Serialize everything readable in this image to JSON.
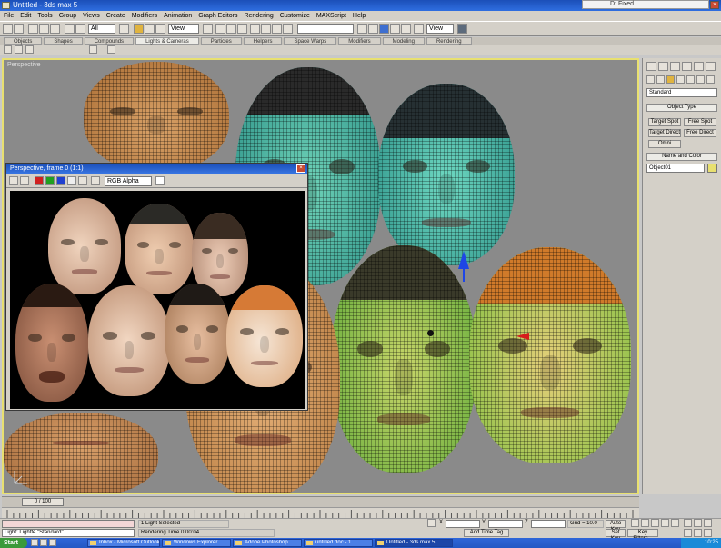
{
  "window": {
    "title": "Untitled - 3ds max 5",
    "peek_text": "D: Fixed"
  },
  "menus": [
    "File",
    "Edit",
    "Tools",
    "Group",
    "Views",
    "Create",
    "Modifiers",
    "Animation",
    "Graph Editors",
    "Rendering",
    "Customize",
    "MAXScript",
    "Help"
  ],
  "toolbar": {
    "count_value": "All",
    "refcoord_value": "View",
    "named_sel_value": "",
    "render_type_value": "View"
  },
  "tabs": [
    "Objects",
    "Shapes",
    "Compounds",
    "Lights & Cameras",
    "Particles",
    "Helpers",
    "Space Warps",
    "Modifiers",
    "Modeling",
    "Rendering"
  ],
  "tabs_active_index": 3,
  "viewport": {
    "label": "Perspective"
  },
  "render_window": {
    "title": "Perspective, frame 0 (1:1)",
    "channel_value": "RGB Alpha"
  },
  "command_panel": {
    "dropdown": "Standard",
    "rollout_object_type": "Object Type",
    "object_buttons": [
      "Target Spot",
      "Free Spot",
      "Target Direct",
      "Free Direct",
      "Omni"
    ],
    "rollout_name_color": "Name and Color",
    "name_field": "Object01"
  },
  "timeline": {
    "frame_indicator": "0 / 100"
  },
  "status": {
    "maxscript_line1": "",
    "maxscript_line2": "Light: Lightfe \"Standard\"",
    "status_message": "1 Light Selected",
    "prompt_message": "Rendering Time 0:00:04",
    "x_label": "X",
    "y_label": "Y",
    "z_label": "Z",
    "add_time_tag": "Add Time Tag",
    "grid_value": "Grid = 10.0",
    "auto_key": "Auto Key",
    "set_key": "Set Key",
    "key_filters": "Key Filters..."
  },
  "taskbar": {
    "start_label": "Start",
    "tasks": [
      "Inbox - Microsoft Outlook",
      "Windows Explorer",
      "Adobe Photoshop",
      "untitled.doc - 1",
      "Untitled - 3ds max 5"
    ],
    "active_task_index": 4,
    "clock": "10:25"
  },
  "colors": {
    "accent_title": "#2f6ee0",
    "viewport_bg": "#8a8a8a",
    "active_viewport_border": "#e8e070",
    "ui_gray": "#d4d0c8"
  }
}
